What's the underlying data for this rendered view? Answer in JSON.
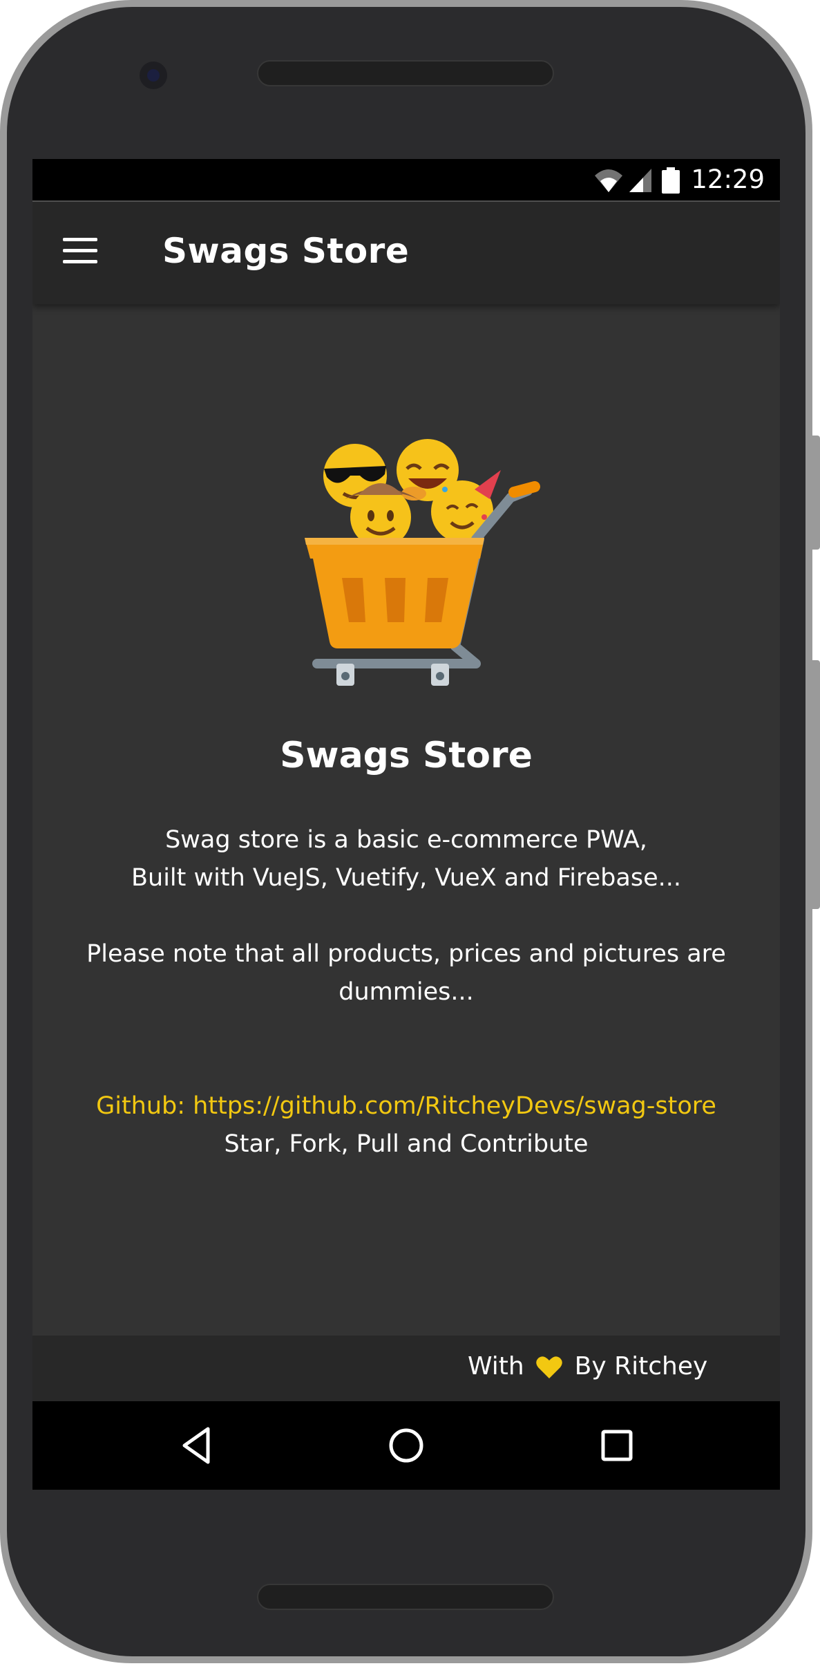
{
  "status_bar": {
    "time": "12:29"
  },
  "app_bar": {
    "title": "Swags Store"
  },
  "content": {
    "title": "Swags Store",
    "description_lines": [
      "Swag store is a basic e-commerce PWA,",
      "Built with VueJS, Vuetify, VueX and Firebase..."
    ],
    "note_lines": [
      "Please note that all products, prices and pictures are",
      "dummies..."
    ],
    "github_link": "Github: https://github.com/RitcheyDevs/swag-store",
    "call_to_action": "Star, Fork, Pull and Contribute"
  },
  "footer": {
    "prefix": "With",
    "suffix": "By Ritchey",
    "heart_color": "#f2c811"
  },
  "colors": {
    "accent": "#f2c811",
    "background": "#333333",
    "app_bar": "#272727"
  },
  "icons": [
    "menu-icon",
    "wifi-icon",
    "signal-icon",
    "battery-icon",
    "back-icon",
    "home-icon",
    "recents-icon",
    "heart-icon",
    "shopping-cart-emoji-logo"
  ]
}
